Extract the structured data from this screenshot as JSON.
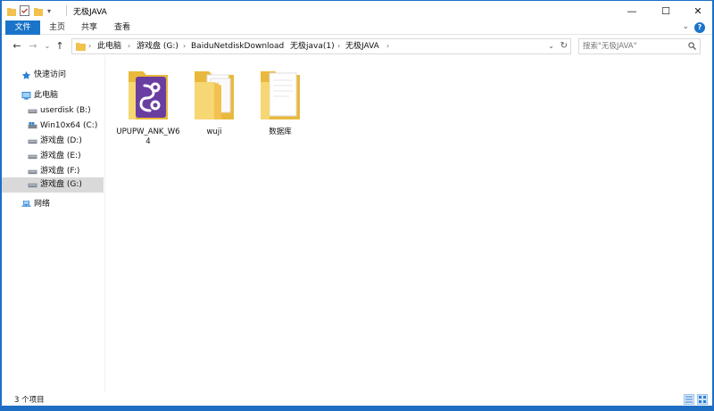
{
  "window": {
    "title": "无极JAVA",
    "controls": {
      "minimize": "—",
      "maximize": "☐",
      "close": "✕"
    }
  },
  "ribbon": {
    "tabs": [
      {
        "label": "文件",
        "active": true
      },
      {
        "label": "主页",
        "active": false
      },
      {
        "label": "共享",
        "active": false
      },
      {
        "label": "查看",
        "active": false
      }
    ],
    "help": "?"
  },
  "address_bar": {
    "crumbs": [
      "此电脑",
      "游戏盘 (G:)",
      "BaiduNetdiskDownload",
      "无极java(1)",
      "无极JAVA"
    ],
    "separator": "›"
  },
  "search": {
    "placeholder": "搜索\"无极JAVA\""
  },
  "nav_pane": {
    "items": [
      {
        "label": "快速访问",
        "icon": "star-icon",
        "indent": 0,
        "selected": false
      },
      {
        "label": "此电脑",
        "icon": "computer-icon",
        "indent": 0,
        "selected": false
      },
      {
        "label": "userdisk (B:)",
        "icon": "drive-icon",
        "indent": 1,
        "selected": false
      },
      {
        "label": "Win10x64 (C:)",
        "icon": "windows-drive-icon",
        "indent": 1,
        "selected": false
      },
      {
        "label": "游戏盘 (D:)",
        "icon": "drive-icon",
        "indent": 1,
        "selected": false
      },
      {
        "label": "游戏盘 (E:)",
        "icon": "drive-icon",
        "indent": 1,
        "selected": false
      },
      {
        "label": "游戏盘 (F:)",
        "icon": "drive-icon",
        "indent": 1,
        "selected": false
      },
      {
        "label": "游戏盘 (G:)",
        "icon": "drive-icon",
        "indent": 1,
        "selected": true
      },
      {
        "label": "网络",
        "icon": "network-icon",
        "indent": 0,
        "selected": false
      }
    ]
  },
  "files": [
    {
      "name": "UPUPW_ANK_W64",
      "icon": "upupw-app-folder-icon"
    },
    {
      "name": "wuji",
      "icon": "folder-with-files-icon"
    },
    {
      "name": "数据库",
      "icon": "folder-with-document-icon"
    }
  ],
  "status": {
    "item_count": "3 个项目"
  },
  "colors": {
    "accent": "#1a74c9",
    "folder": "#f7d774",
    "upupw_purple": "#6a3ea1"
  }
}
